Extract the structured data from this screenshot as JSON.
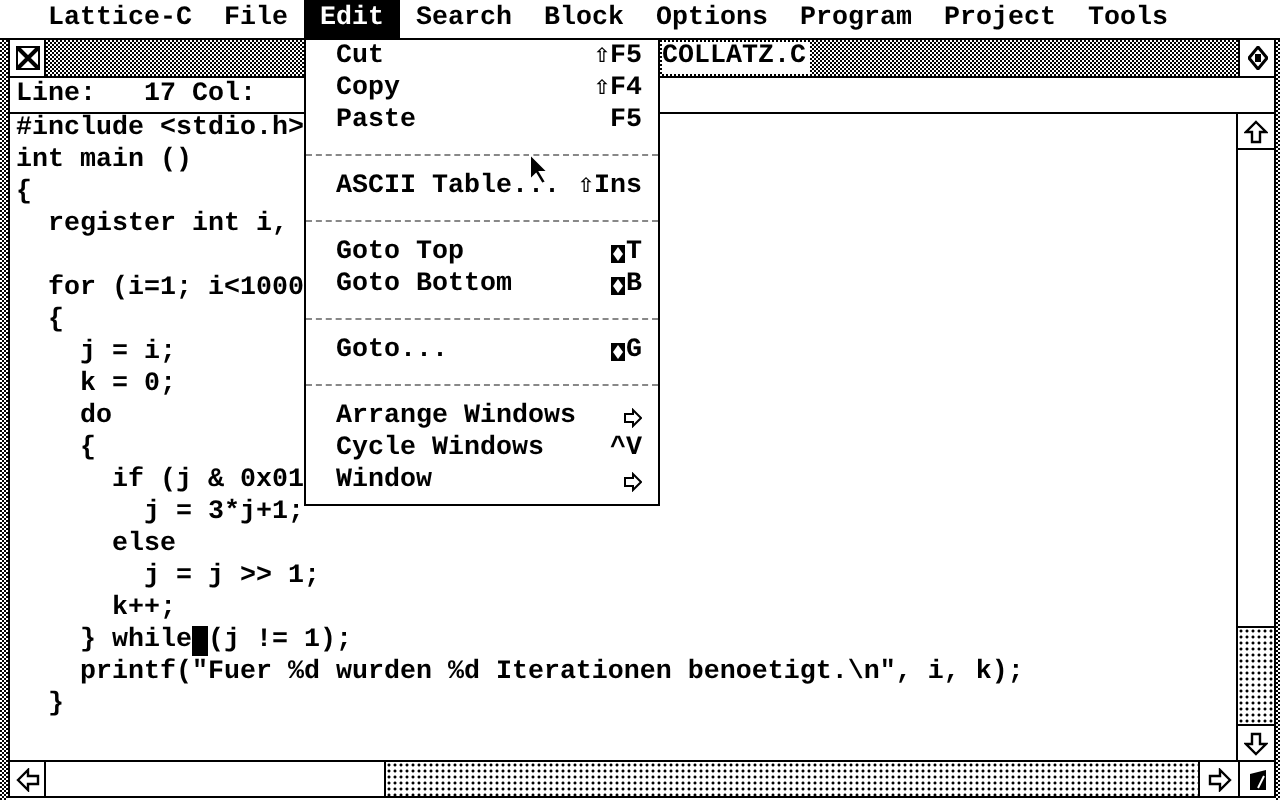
{
  "menu_bar": [
    {
      "label": "Lattice-C",
      "selected": false
    },
    {
      "label": "File",
      "selected": false
    },
    {
      "label": "Edit",
      "selected": true
    },
    {
      "label": "Search",
      "selected": false
    },
    {
      "label": "Block",
      "selected": false
    },
    {
      "label": "Options",
      "selected": false
    },
    {
      "label": "Program",
      "selected": false
    },
    {
      "label": "Project",
      "selected": false
    },
    {
      "label": "Tools",
      "selected": false
    }
  ],
  "window": {
    "title": "COLLATZ.C",
    "info": "Line:   17 Col:"
  },
  "code": {
    "lines": [
      {
        "kind": "text",
        "text": "#include <stdio.h>"
      },
      {
        "kind": "text",
        "text": "int main ()"
      },
      {
        "kind": "text",
        "text": "{"
      },
      {
        "kind": "text",
        "text": "  register int i,"
      },
      {
        "kind": "blank"
      },
      {
        "kind": "text",
        "text": "  for (i=1; i<1000"
      },
      {
        "kind": "text",
        "text": "  {"
      },
      {
        "kind": "text",
        "text": "    j = i;"
      },
      {
        "kind": "text",
        "text": "    k = 0;"
      },
      {
        "kind": "text",
        "text": "    do"
      },
      {
        "kind": "text",
        "text": "    {"
      },
      {
        "kind": "text",
        "text": "      if (j & 0x01"
      },
      {
        "kind": "text",
        "text": "        j = 3*j+1;"
      },
      {
        "kind": "text",
        "text": "      else"
      },
      {
        "kind": "text",
        "text": "        j = j >> 1;"
      },
      {
        "kind": "text",
        "text": "      k++;"
      },
      {
        "kind": "cursor",
        "before": "    } while",
        "after": "(j != 1);"
      },
      {
        "kind": "text",
        "text": "    printf(\"Fuer %d wurden %d Iterationen benoetigt.\\n\", i, k);"
      },
      {
        "kind": "text",
        "text": "  }"
      }
    ]
  },
  "dropdown": {
    "items": [
      {
        "kind": "item",
        "label": "Cut",
        "shortcut": "⇧F5",
        "alternate_key": false
      },
      {
        "kind": "item",
        "label": "Copy",
        "shortcut": "⇧F4",
        "alternate_key": false
      },
      {
        "kind": "item",
        "label": "Paste",
        "shortcut": "F5",
        "alternate_key": false
      },
      {
        "kind": "separator"
      },
      {
        "kind": "item",
        "label": "ASCII Table...",
        "shortcut": "⇧Ins",
        "alternate_key": false
      },
      {
        "kind": "separator"
      },
      {
        "kind": "item",
        "label": "Goto Top",
        "shortcut": "T",
        "alternate_key": true
      },
      {
        "kind": "item",
        "label": "Goto Bottom",
        "shortcut": "B",
        "alternate_key": true
      },
      {
        "kind": "separator"
      },
      {
        "kind": "item",
        "label": "Goto...",
        "shortcut": "G",
        "alternate_key": true
      },
      {
        "kind": "separator"
      },
      {
        "kind": "submenu",
        "label": "Arrange Windows"
      },
      {
        "kind": "item",
        "label": "Cycle Windows",
        "shortcut": "^V",
        "alternate_key": false
      },
      {
        "kind": "submenu",
        "label": "Window"
      }
    ]
  }
}
